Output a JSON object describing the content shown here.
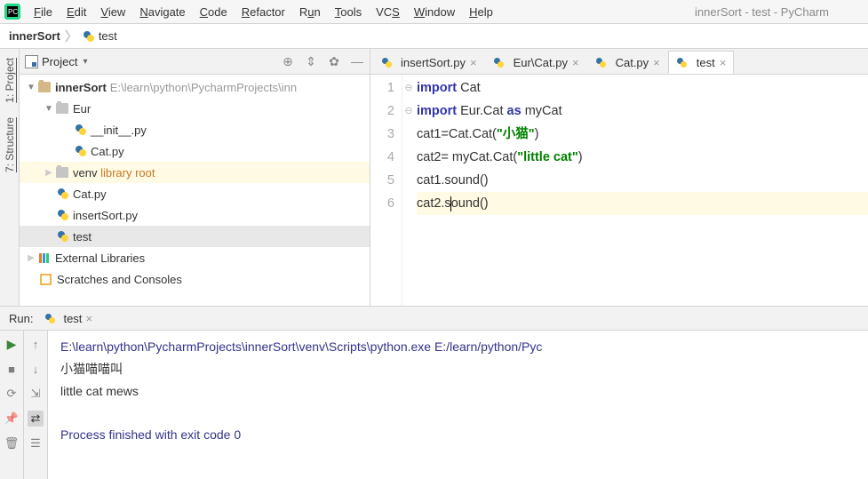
{
  "window_title": "innerSort - test - PyCharm",
  "menu": {
    "items": [
      "File",
      "Edit",
      "View",
      "Navigate",
      "Code",
      "Refactor",
      "Run",
      "Tools",
      "VCS",
      "Window",
      "Help"
    ]
  },
  "breadcrumb": {
    "root": "innerSort",
    "file": "test"
  },
  "sidebar_tabs": {
    "project": "1: Project",
    "structure": "7: Structure"
  },
  "project_pane": {
    "title": "Project",
    "tree": {
      "root_name": "innerSort",
      "root_path": "E:\\learn\\python\\PycharmProjects\\inn",
      "eur_folder": "Eur",
      "init_py": "__init__.py",
      "cat_py": "Cat.py",
      "venv": "venv",
      "lib_root": "library root",
      "cat_py2": "Cat.py",
      "insertsort": "insertSort.py",
      "test": "test",
      "ext_lib": "External Libraries",
      "scratches": "Scratches and Consoles"
    }
  },
  "editor_tabs": [
    {
      "name": "insertSort.py",
      "active": false
    },
    {
      "name": "Eur\\Cat.py",
      "active": false
    },
    {
      "name": "Cat.py",
      "active": false
    },
    {
      "name": "test",
      "active": true
    }
  ],
  "code": {
    "lines": [
      {
        "n": 1,
        "pre": "",
        "kw": "import",
        "rest": " Cat"
      },
      {
        "n": 2,
        "pre": "",
        "kw": "import",
        "mid": " Eur.Cat ",
        "kw2": "as",
        "rest": " myCat"
      },
      {
        "n": 3,
        "plain_a": "cat1=Cat.Cat(",
        "str": "\"小猫\"",
        "plain_b": ")"
      },
      {
        "n": 4,
        "plain_a": "cat2= myCat.Cat(",
        "str": "\"little cat\"",
        "plain_b": ")"
      },
      {
        "n": 5,
        "plain_a": "cat1.sound()"
      },
      {
        "n": 6,
        "plain_a": "cat2.s",
        "caret": true,
        "plain_b": "ound()"
      }
    ]
  },
  "run_panel": {
    "title": "Run:",
    "tab": "test",
    "output_path": "E:\\learn\\python\\PycharmProjects\\innerSort\\venv\\Scripts\\python.exe E:/learn/python/Pyc",
    "line2": "小猫喵喵叫",
    "line3": "little cat mews",
    "exit_msg": "Process finished with exit code 0"
  }
}
